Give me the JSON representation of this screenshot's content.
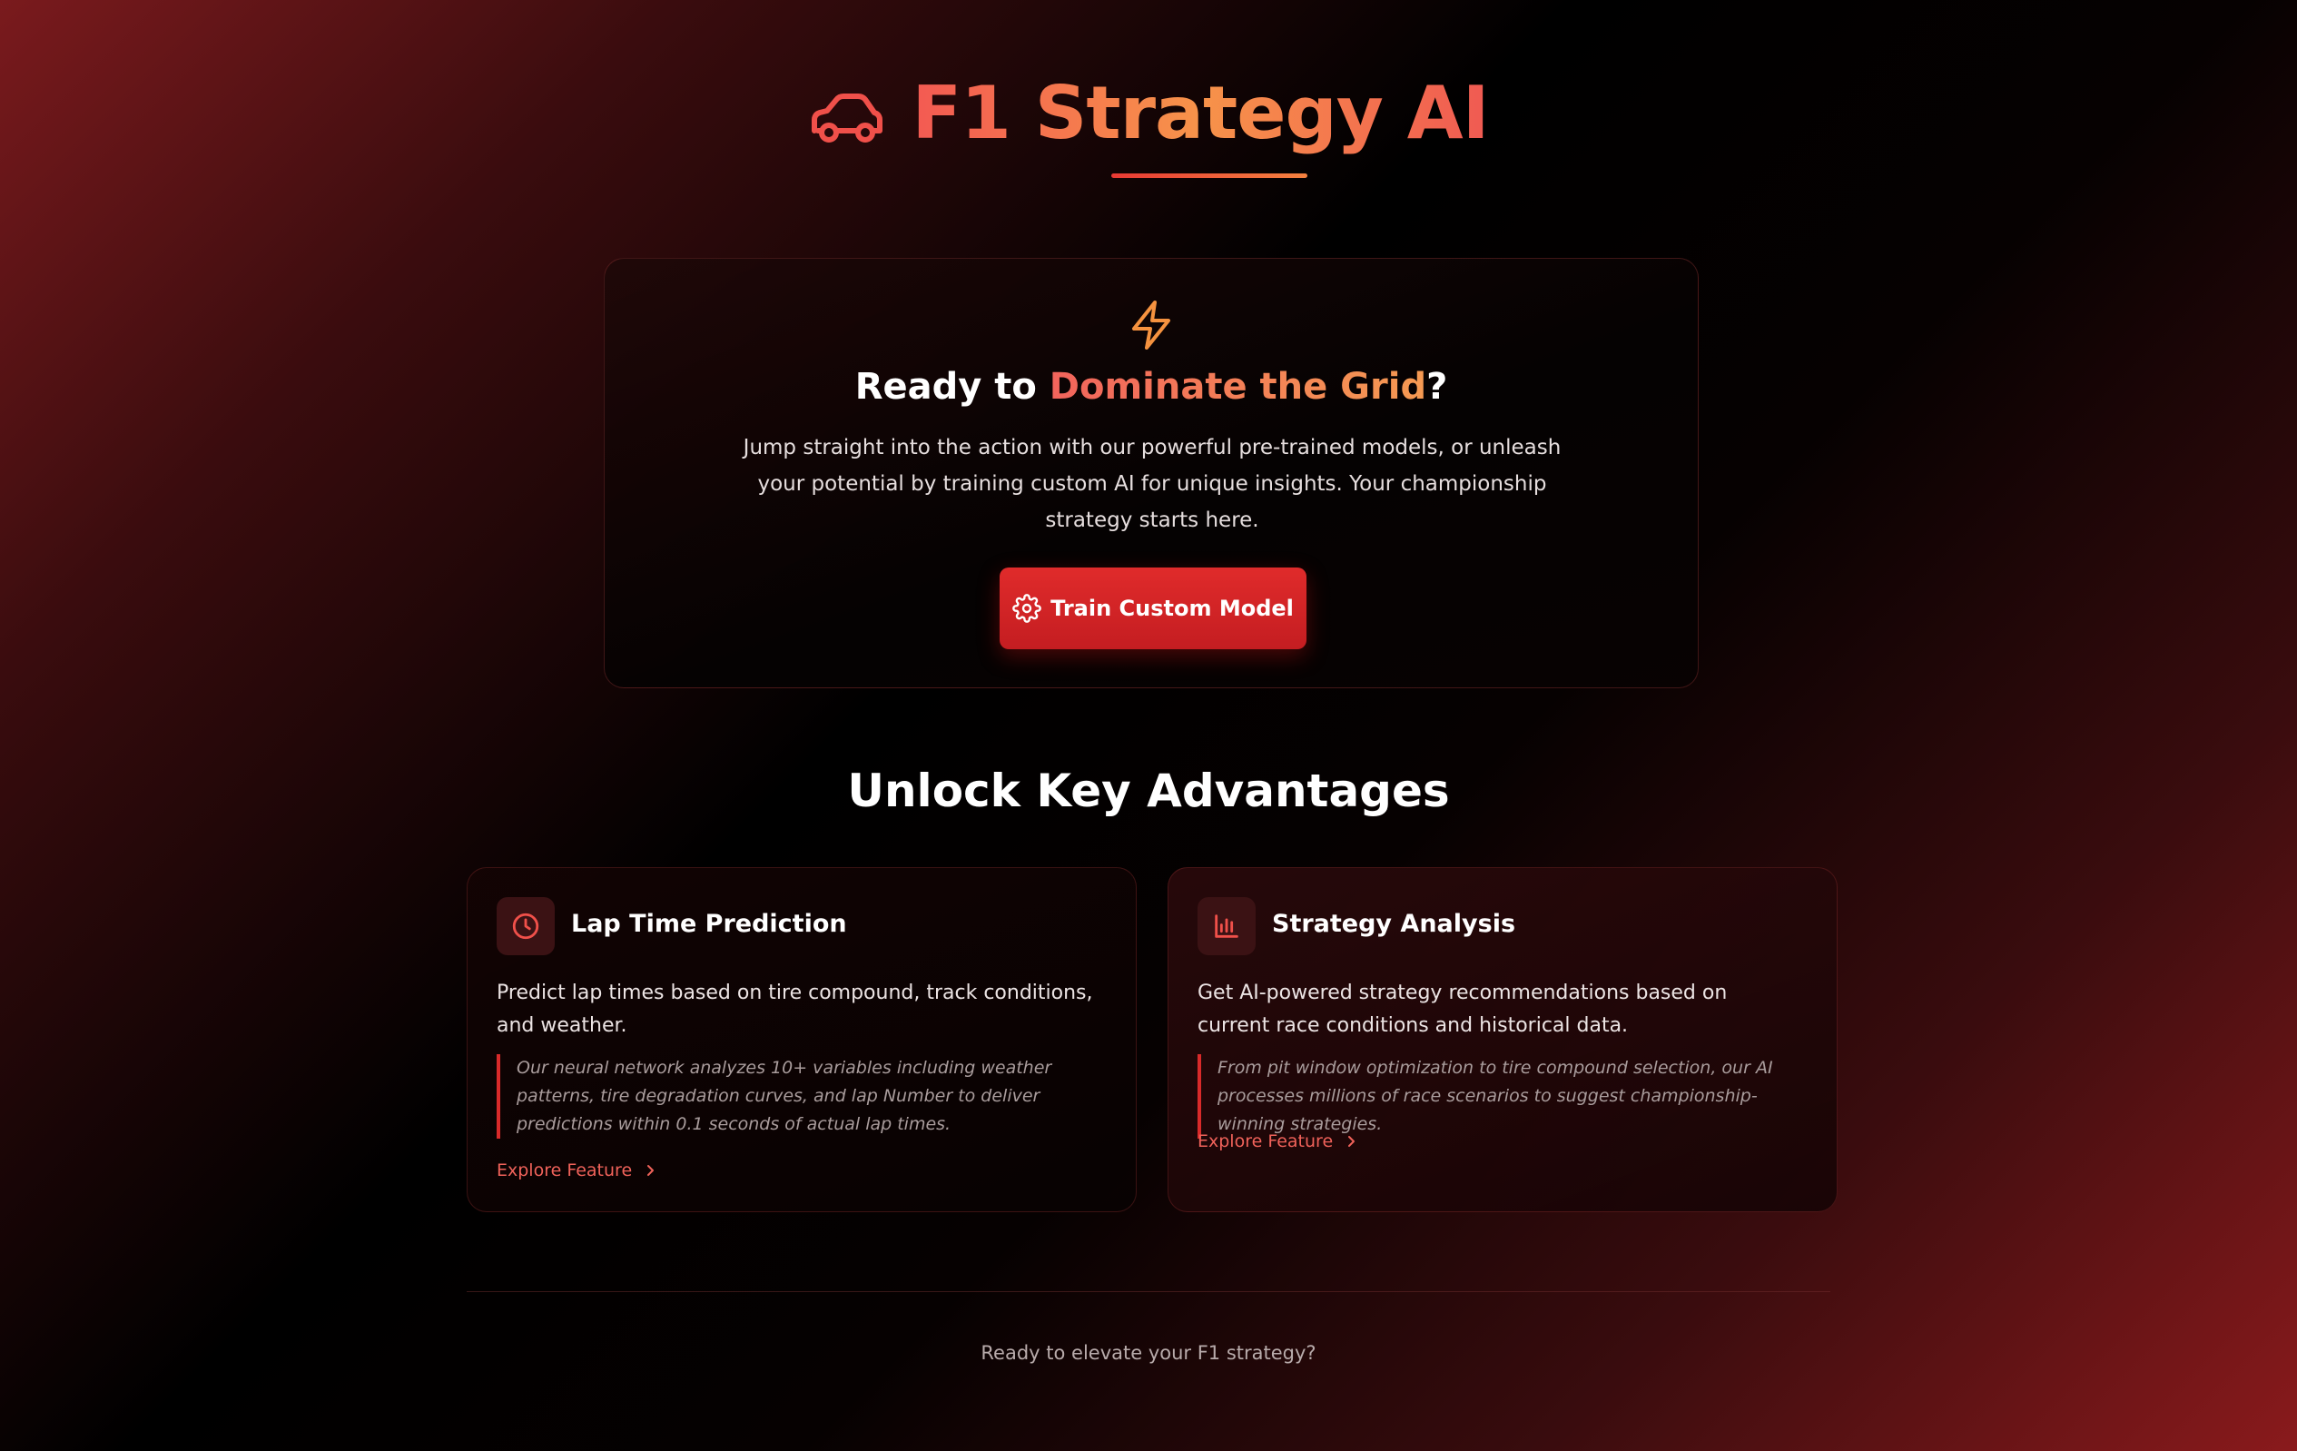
{
  "header": {
    "title": "F1 Strategy AI",
    "icon": "car-icon"
  },
  "hero": {
    "icon": "lightning-bolt-icon",
    "heading_prefix": "Ready to ",
    "heading_accent": "Dominate the Grid",
    "heading_suffix": "?",
    "body": "Jump straight into the action with our powerful pre-trained models, or unleash your potential by training custom AI for unique insights. Your championship strategy starts here.",
    "button_label": "Train Custom Model",
    "button_icon": "gear-icon"
  },
  "advantages": {
    "title": "Unlock Key Advantages",
    "features": [
      {
        "icon": "clock-icon",
        "title": "Lap Time Prediction",
        "description": "Predict lap times based on tire compound, track conditions, and weather.",
        "detail": "Our neural network analyzes 10+ variables including weather patterns, tire degradation curves, and lap Number to deliver predictions within 0.1 seconds of actual lap times.",
        "link_label": "Explore Feature"
      },
      {
        "icon": "bar-chart-icon",
        "title": "Strategy Analysis",
        "description": "Get AI-powered strategy recommendations based on current race conditions and historical data.",
        "detail": "From pit window optimization to tire compound selection, our AI processes millions of race scenarios to suggest championship-winning strategies.",
        "link_label": "Explore Feature"
      }
    ]
  },
  "footer": {
    "text": "Ready to elevate your F1 strategy?"
  },
  "colors": {
    "accent_red": "#e02b2b",
    "accent_orange": "#f59a52",
    "link_red": "#f0625a"
  }
}
